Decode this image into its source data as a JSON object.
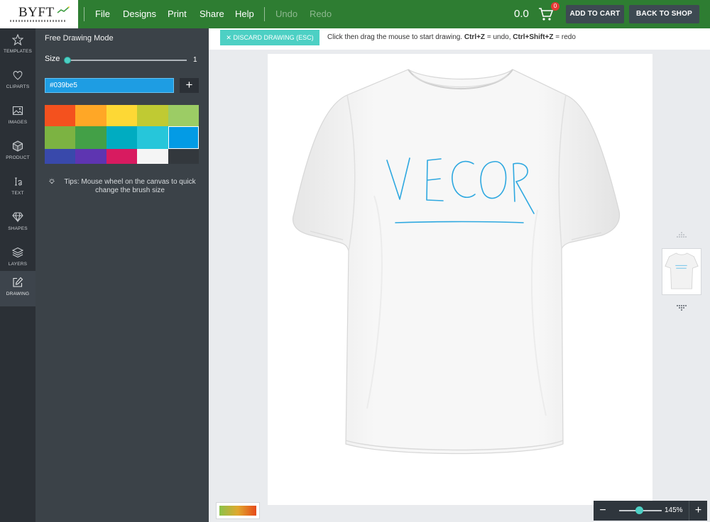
{
  "app": {
    "logo_text": "BYFT"
  },
  "menu": [
    "File",
    "Designs",
    "Print",
    "Share",
    "Help"
  ],
  "history": {
    "undo": "Undo",
    "redo": "Redo"
  },
  "cart": {
    "price": "0.0",
    "count": "0",
    "add_to_cart": "ADD TO CART",
    "back_to_shop": "BACK TO SHOP"
  },
  "rail": [
    {
      "label": "TEMPLATES",
      "icon": "star-icon"
    },
    {
      "label": "CLIPARTS",
      "icon": "heart-icon"
    },
    {
      "label": "IMAGES",
      "icon": "image-icon"
    },
    {
      "label": "PRODUCT",
      "icon": "cube-icon"
    },
    {
      "label": "TEXT",
      "icon": "text-icon"
    },
    {
      "label": "SHAPES",
      "icon": "diamond-icon"
    },
    {
      "label": "LAYERS",
      "icon": "layers-icon"
    },
    {
      "label": "DRAWING",
      "icon": "pencil-icon",
      "active": true
    }
  ],
  "panel": {
    "title": "Free Drawing Mode",
    "size_label": "Size",
    "size_value": "1",
    "color_value": "#039be5",
    "add_color_label": "+",
    "tips": "Tips: Mouse wheel on the canvas to quick change the brush size"
  },
  "swatches": [
    [
      "#f4511e",
      "#ffa726",
      "#fdd835",
      "#c0ca33",
      "#9ccc65"
    ],
    [
      "#7cb342",
      "#43a047",
      "#00acc1",
      "#26c6da",
      "#039be5"
    ],
    [
      "#3949ab",
      "#5e35b1",
      "#d81b60",
      "#f5f5f5",
      "#33383d"
    ]
  ],
  "drawbar": {
    "discard_label": "DISCARD DRAWING (ESC)",
    "hint_text": "Click then drag the mouse to start drawing.",
    "hint_undo_key": "Ctrl+Z",
    "hint_undo": "= undo,",
    "hint_redo_key": "Ctrl+Shift+Z",
    "hint_redo": "= redo"
  },
  "canvas": {
    "drawing_text": "VECOR",
    "stroke_color": "#2ea8e0"
  },
  "zoom": {
    "minus": "−",
    "value": "145%",
    "plus": "+",
    "level_fraction": 0.45
  },
  "colors": {
    "topbar": "#2e7d32",
    "accent": "#4dd0c4",
    "panel": "#3b4248",
    "rail": "#2b3036"
  }
}
